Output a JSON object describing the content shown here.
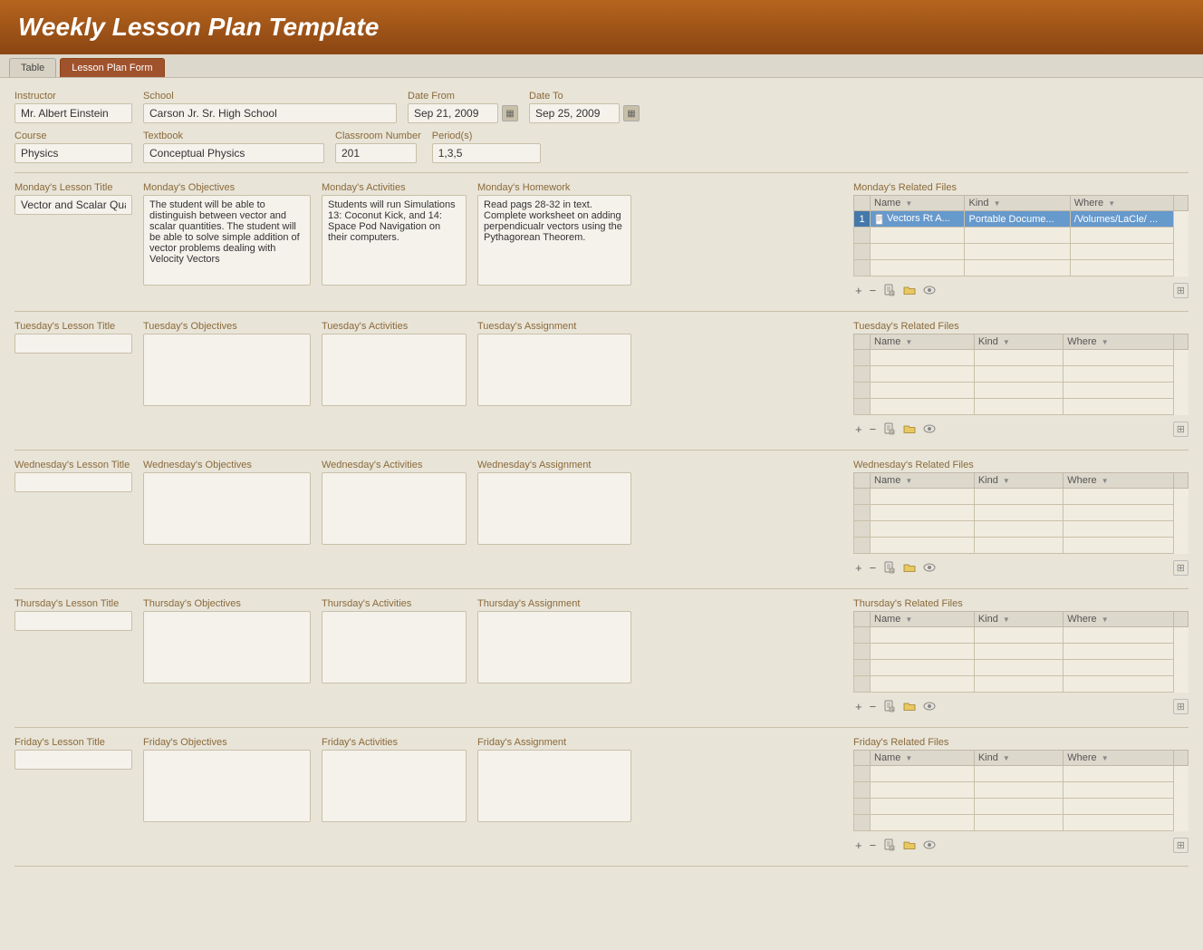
{
  "header": {
    "title": "Weekly Lesson Plan Template"
  },
  "tabs": [
    {
      "id": "table",
      "label": "Table",
      "active": false
    },
    {
      "id": "lesson-plan-form",
      "label": "Lesson Plan Form",
      "active": true
    }
  ],
  "form": {
    "instructor_label": "Instructor",
    "instructor_value": "Mr. Albert Einstein",
    "school_label": "School",
    "school_value": "Carson Jr. Sr. High School",
    "date_from_label": "Date From",
    "date_from_value": "Sep 21, 2009",
    "date_to_label": "Date To",
    "date_to_value": "Sep 25, 2009",
    "course_label": "Course",
    "course_value": "Physics",
    "textbook_label": "Textbook",
    "textbook_value": "Conceptual Physics",
    "classroom_label": "Classroom Number",
    "classroom_value": "201",
    "periods_label": "Period(s)",
    "periods_value": "1,3,5"
  },
  "days": [
    {
      "id": "monday",
      "title_label": "Monday's Lesson Title",
      "title_value": "Vector and Scalar Quantities",
      "obj_label": "Monday's Objectives",
      "obj_value": "The student will be able to distinguish between vector and scalar quantities. The student will be able to solve simple addition of vector problems dealing with Velocity Vectors",
      "act_label": "Monday's Activities",
      "act_value": "Students will run Simulations 13: Coconut Kick, and 14: Space Pod Navigation on their computers.",
      "hw_label": "Monday's Homework",
      "hw_value": "Read pags 28-32 in text. Complete worksheet on adding perpendicualr vectors using the Pythagorean Theorem.",
      "files_label": "Monday's Related Files",
      "files": [
        {
          "num": "1",
          "name": "Vectors Rt A...",
          "kind": "Portable Docume...",
          "where": "/Volumes/LaCle/ ...",
          "selected": true
        }
      ]
    },
    {
      "id": "tuesday",
      "title_label": "Tuesday's Lesson Title",
      "title_value": "",
      "obj_label": "Tuesday's Objectives",
      "obj_value": "",
      "act_label": "Tuesday's Activities",
      "act_value": "",
      "hw_label": "Tuesday's Assignment",
      "hw_value": "",
      "files_label": "Tuesday's Related Files",
      "files": []
    },
    {
      "id": "wednesday",
      "title_label": "Wednesday's Lesson Title",
      "title_value": "",
      "obj_label": "Wednesday's Objectives",
      "obj_value": "",
      "act_label": "Wednesday's Activities",
      "act_value": "",
      "hw_label": "Wednesday's Assignment",
      "hw_value": "",
      "files_label": "Wednesday's Related Files",
      "files": []
    },
    {
      "id": "thursday",
      "title_label": "Thursday's Lesson Title",
      "title_value": "",
      "obj_label": "Thursday's Objectives",
      "obj_value": "",
      "act_label": "Thursday's Activities",
      "act_value": "",
      "hw_label": "Thursday's Assignment",
      "hw_value": "",
      "files_label": "Thursday's Related Files",
      "files": []
    },
    {
      "id": "friday",
      "title_label": "Friday's Lesson Title",
      "title_value": "",
      "obj_label": "Friday's Objectives",
      "obj_value": "",
      "act_label": "Friday's Activities",
      "act_value": "",
      "hw_label": "Friday's Assignment",
      "hw_value": "",
      "files_label": "Friday's Related Files",
      "files": []
    }
  ],
  "files_table_headers": {
    "name": "Name",
    "kind": "Kind",
    "where": "Where"
  },
  "toolbar_icons": {
    "add": "+",
    "remove": "−",
    "new_doc": "📄",
    "folder": "📂",
    "eye": "👁"
  }
}
